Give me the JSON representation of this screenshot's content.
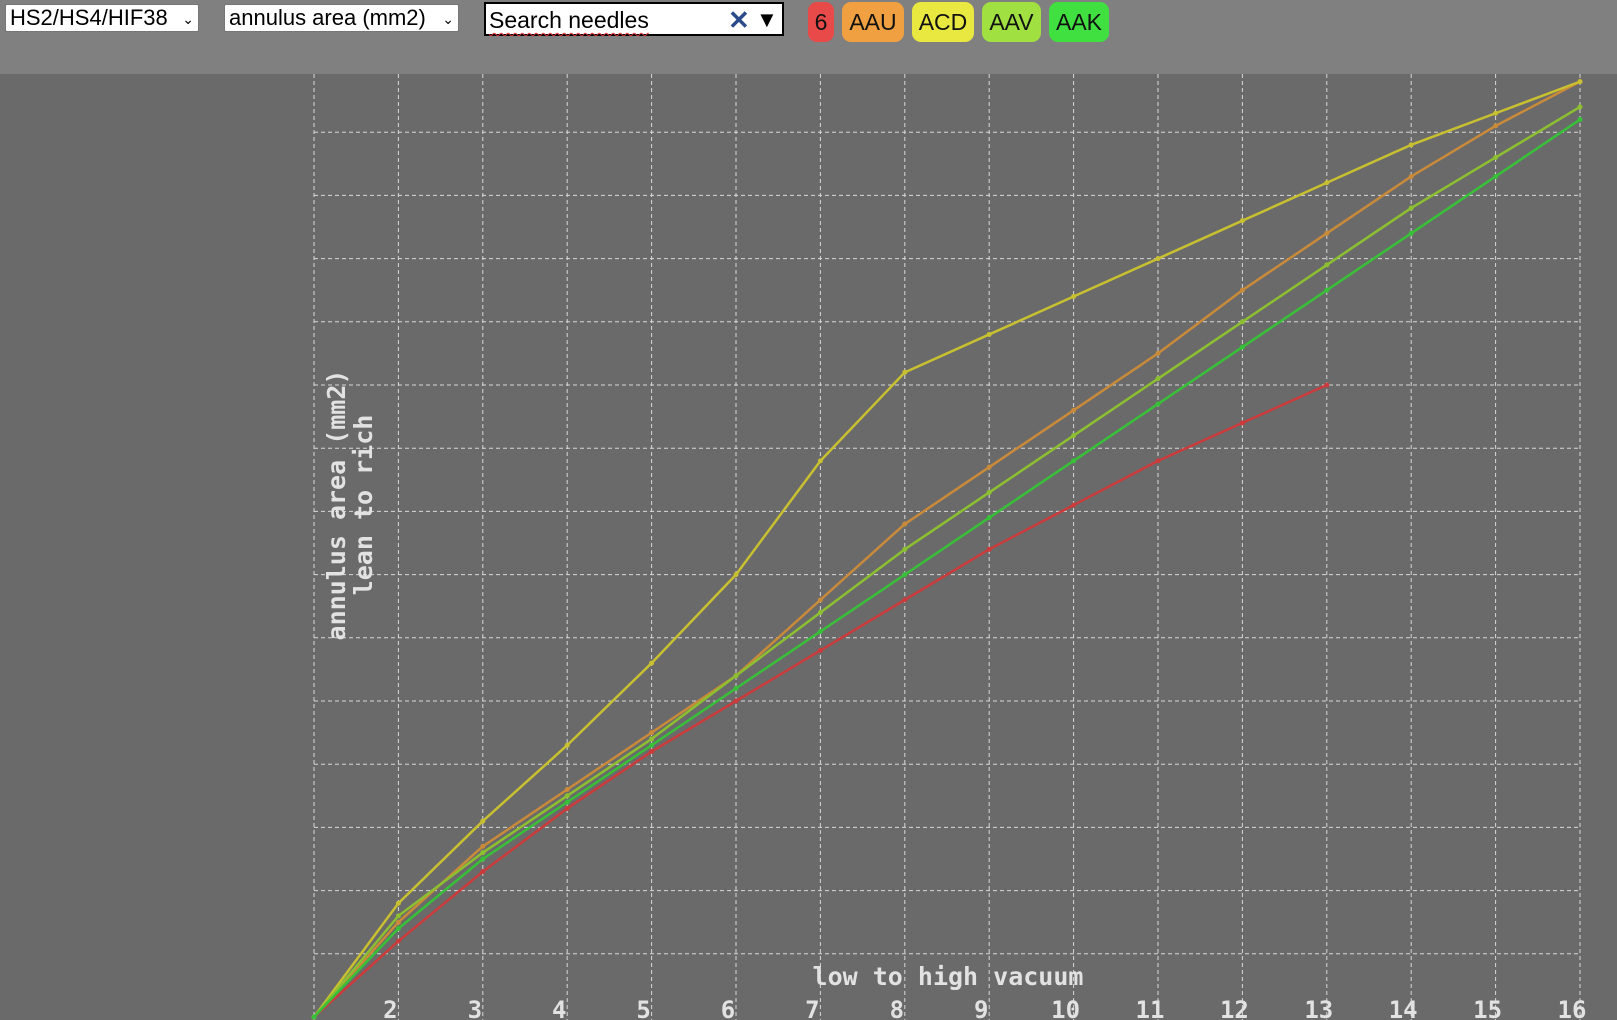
{
  "toolbar": {
    "carb_select": {
      "value": "HS2/HS4/HIF38"
    },
    "measure_select": {
      "value": "annulus area (mm2)"
    },
    "search": {
      "placeholder": "Search needles",
      "clear_icon": "close-icon",
      "dropdown_icon": "triangle-down-icon"
    },
    "needle_chips": [
      {
        "label": "6",
        "color": "#e84a4a"
      },
      {
        "label": "AAU",
        "color": "#f0a040"
      },
      {
        "label": "ACD",
        "color": "#e8e840"
      },
      {
        "label": "AAV",
        "color": "#a0e040"
      },
      {
        "label": "AAK",
        "color": "#40e040"
      }
    ]
  },
  "chart_data": {
    "type": "line",
    "xlabel": "low to high vacuum",
    "ylabel": "annulus area (mm2)",
    "ylabel2": "lean to rich",
    "xlim": [
      1,
      16
    ],
    "ylim": [
      0,
      15
    ],
    "x_ticks": [
      2,
      3,
      4,
      5,
      6,
      7,
      8,
      9,
      10,
      11,
      12,
      13,
      14,
      15,
      16
    ],
    "grid": true,
    "grid_style": "dashed",
    "series": [
      {
        "name": "6",
        "color": "#cc3b3b",
        "x": [
          1,
          2,
          3,
          4,
          5,
          6,
          7,
          8,
          9,
          10,
          11,
          12,
          13
        ],
        "y": [
          0,
          1.2,
          2.3,
          3.3,
          4.2,
          5.0,
          5.8,
          6.6,
          7.4,
          8.1,
          8.8,
          9.4,
          10.0
        ]
      },
      {
        "name": "AAU",
        "color": "#c98a3a",
        "x": [
          1,
          2,
          3,
          4,
          5,
          6,
          7,
          8,
          9,
          10,
          11,
          12,
          13,
          14,
          15,
          16
        ],
        "y": [
          0,
          1.5,
          2.7,
          3.6,
          4.5,
          5.4,
          6.6,
          7.8,
          8.7,
          9.6,
          10.5,
          11.5,
          12.4,
          13.3,
          14.1,
          14.8
        ]
      },
      {
        "name": "ACD",
        "color": "#c8c030",
        "x": [
          1,
          2,
          3,
          4,
          5,
          6,
          7,
          8,
          9,
          10,
          11,
          12,
          13,
          14,
          15,
          16
        ],
        "y": [
          0,
          1.8,
          3.1,
          4.3,
          5.6,
          7.0,
          8.8,
          10.2,
          10.8,
          11.4,
          12.0,
          12.6,
          13.2,
          13.8,
          14.3,
          14.8
        ]
      },
      {
        "name": "AAV",
        "color": "#8cc030",
        "x": [
          1,
          2,
          3,
          4,
          5,
          6,
          7,
          8,
          9,
          10,
          11,
          12,
          13,
          14,
          15,
          16
        ],
        "y": [
          0,
          1.6,
          2.6,
          3.5,
          4.4,
          5.4,
          6.4,
          7.4,
          8.3,
          9.2,
          10.1,
          11.0,
          11.9,
          12.8,
          13.6,
          14.4
        ]
      },
      {
        "name": "AAK",
        "color": "#38c038",
        "x": [
          1,
          2,
          3,
          4,
          5,
          6,
          7,
          8,
          9,
          10,
          11,
          12,
          13,
          14,
          15,
          16
        ],
        "y": [
          0,
          1.4,
          2.5,
          3.4,
          4.3,
          5.2,
          6.1,
          7.0,
          7.9,
          8.8,
          9.7,
          10.6,
          11.5,
          12.4,
          13.3,
          14.2
        ]
      }
    ]
  }
}
